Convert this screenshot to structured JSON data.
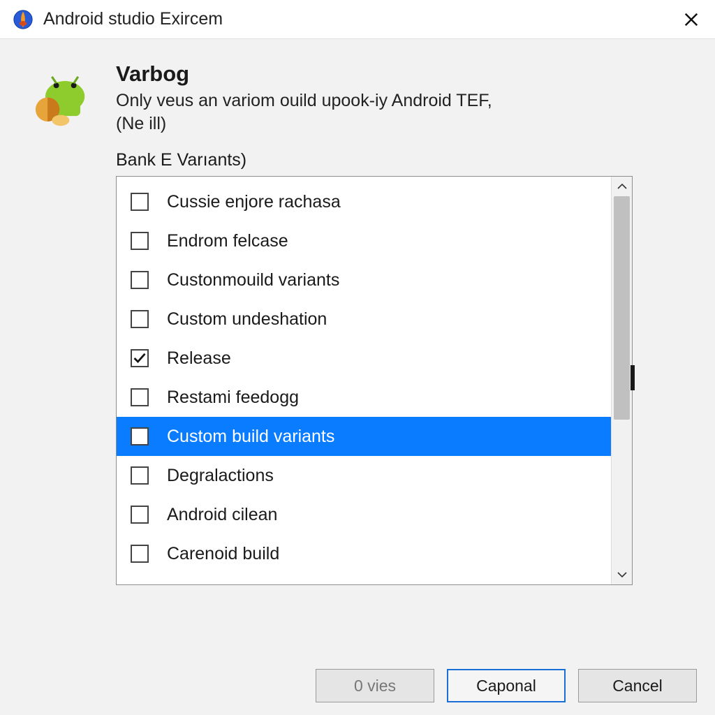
{
  "window": {
    "title": "Android studio Exircem"
  },
  "header": {
    "heading": "Varbog",
    "description_line1": "Only veus an variom ouild upook-iy Android TEF,",
    "description_line2": "(Ne ill)"
  },
  "list": {
    "label": "Bank E Varıants)",
    "items": [
      {
        "label": "Cussie enjore rachasa",
        "checked": false,
        "selected": false
      },
      {
        "label": "Endrom felcase",
        "checked": false,
        "selected": false
      },
      {
        "label": "Custonmouild variants",
        "checked": false,
        "selected": false
      },
      {
        "label": "Custom undeshation",
        "checked": false,
        "selected": false
      },
      {
        "label": "Release",
        "checked": true,
        "selected": false
      },
      {
        "label": "Restami feedogg",
        "checked": false,
        "selected": false
      },
      {
        "label": "Custom build variants",
        "checked": false,
        "selected": true
      },
      {
        "label": "Degralactions",
        "checked": false,
        "selected": false
      },
      {
        "label": "Android cilean",
        "checked": false,
        "selected": false
      },
      {
        "label": "Carenoid build",
        "checked": false,
        "selected": false
      }
    ]
  },
  "buttons": {
    "disabled": "0 vies",
    "primary": "Caponal",
    "cancel": "Cancel"
  }
}
